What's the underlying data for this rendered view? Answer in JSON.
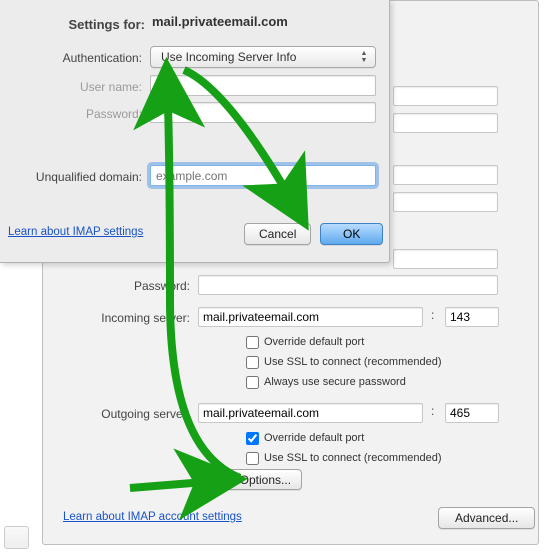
{
  "dialog": {
    "title_label": "Settings for:",
    "title_value": "mail.privateemail.com",
    "auth_label": "Authentication:",
    "auth_value": "Use Incoming Server Info",
    "username_label": "User name:",
    "username_value": "",
    "password_label": "Password:",
    "password_value": "",
    "unqualified_label": "Unqualified domain:",
    "unqualified_placeholder": "example.com",
    "cancel": "Cancel",
    "ok": "OK",
    "imap_link": "Learn about IMAP settings"
  },
  "main": {
    "password_label": "Password:",
    "password_value": "",
    "incoming_label": "Incoming server:",
    "incoming_value": "mail.privateemail.com",
    "incoming_port": "143",
    "outgoing_label": "Outgoing server:",
    "outgoing_value": "mail.privateemail.com",
    "outgoing_port": "465",
    "chk_override": "Override default port",
    "chk_ssl": "Use SSL to connect (recommended)",
    "chk_secure": "Always use secure password",
    "more_options": "More Options...",
    "imap_link": "Learn about IMAP account settings",
    "advanced": "Advanced..."
  }
}
